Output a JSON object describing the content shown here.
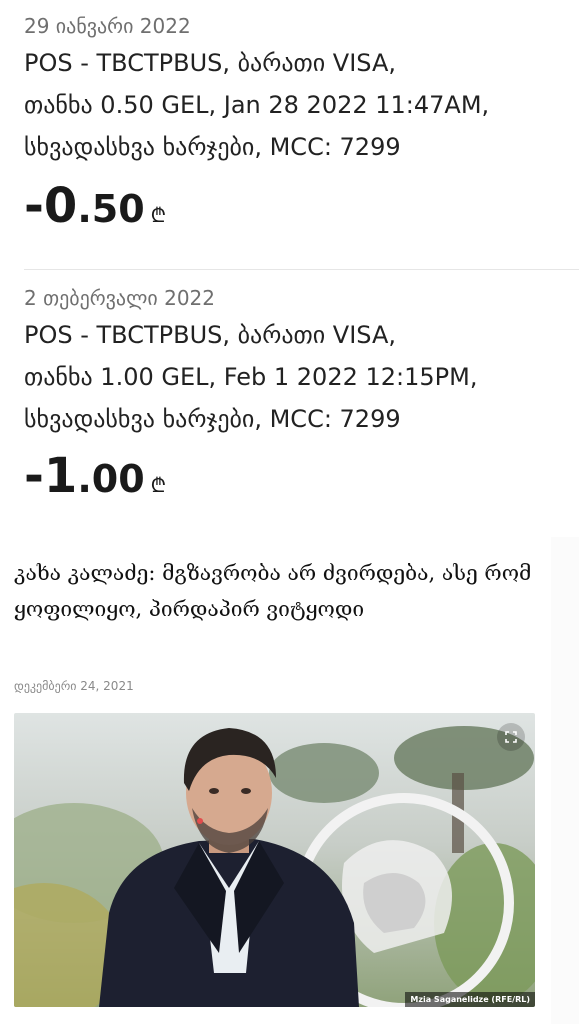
{
  "transactions": [
    {
      "date": "29 იანვარი 2022",
      "description_lines": [
        "POS - TBCTPBUS, ბარათი VISA,",
        "თანხა 0.50 GEL, Jan 28 2022 11:47AM,",
        "სხვადასხვა ხარჯები, MCC: 7299"
      ],
      "amount_int": "-0",
      "amount_dec": ".50",
      "currency": "₾"
    },
    {
      "date": "2 თებერვალი 2022",
      "description_lines": [
        "POS - TBCTPBUS, ბარათი VISA,",
        "თანხა 1.00 GEL, Feb  1 2022 12:15PM,",
        "სხვადასხვა ხარჯები, MCC: 7299"
      ],
      "amount_int": "-1",
      "amount_dec": ".00",
      "currency": "₾"
    }
  ],
  "news": {
    "headline": "კახა კალაძე: მგზავრობა არ ძვირდება, ასე რომ ყოფილიყო, პირდაპირ ვიტყოდი",
    "date": "დეკემბერი 24, 2021",
    "photo_credit": "Mzia Saganelidze (RFE/RL)",
    "expand_icon": "expand-icon"
  },
  "colors": {
    "date_gray": "#6f6f6f",
    "text_dark": "#1f1f1f",
    "divider": "#e6e6e6"
  }
}
